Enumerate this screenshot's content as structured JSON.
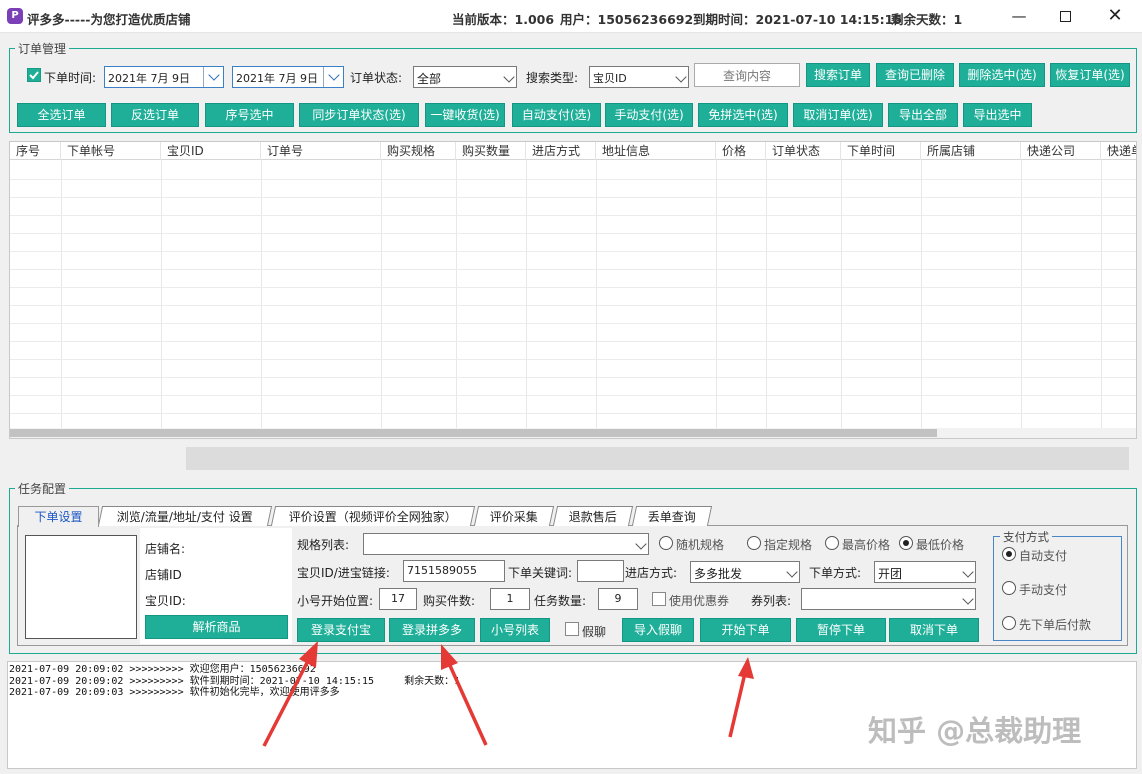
{
  "window": {
    "title": "评多多-----为您打造优质店铺",
    "version_label": "当前版本：1.006",
    "user_label": "用户：15056236692",
    "expiry_label": "到期时间：2021-07-10 14:15:15",
    "days_left_label": "剩余天数：1"
  },
  "order_panel": {
    "legend": "订单管理",
    "order_time_label": "下单时间:",
    "date_from": "2021年  7月  9日",
    "date_to": "2021年  7月  9日",
    "order_status_label": "订单状态:",
    "order_status_value": "全部",
    "search_type_label": "搜索类型:",
    "search_type_value": "宝贝ID",
    "query_placeholder": "查询内容",
    "buttons_row1": [
      "搜索订单",
      "查询已删除",
      "删除选中(选)",
      "恢复订单(选)"
    ],
    "buttons_row2": [
      "全选订单",
      "反选订单",
      "序号选中",
      "同步订单状态(选)",
      "一键收货(选)",
      "自动支付(选)",
      "手动支付(选)",
      "免拼选中(选)",
      "取消订单(选)",
      "导出全部",
      "导出选中"
    ]
  },
  "table": {
    "columns": [
      "序号",
      "下单帐号",
      "宝贝ID",
      "订单号",
      "购买规格",
      "购买数量",
      "进店方式",
      "地址信息",
      "价格",
      "订单状态",
      "下单时间",
      "所属店铺",
      "快递公司",
      "快递单"
    ],
    "rows": []
  },
  "task_panel": {
    "legend": "任务配置",
    "tabs": [
      "下单设置",
      "浏览/流量/地址/支付 设置",
      "评价设置（视频评价全网独家）",
      "评价采集",
      "退款售后",
      "丢单查询"
    ],
    "active_tab": "下单设置",
    "shop_name_label": "店铺名:",
    "shop_id_label": "店铺ID",
    "item_id_label": "宝贝ID:",
    "parse_button": "解析商品",
    "spec_list_label": "规格列表:",
    "spec_list_value": "",
    "spec_options": [
      "随机规格",
      "指定规格",
      "最高价格",
      "最低价格"
    ],
    "spec_selected": "最低价格",
    "item_link_label": "宝贝ID/进宝链接:",
    "item_link_value": "7151589055",
    "keyword_label": "下单关键词:",
    "keyword_value": "",
    "entry_method_label": "进店方式:",
    "entry_method_value": "多多批发",
    "order_method_label": "下单方式:",
    "order_method_value": "开团",
    "start_pos_label": "小号开始位置:",
    "start_pos_value": "17",
    "purchase_count_label": "购买件数:",
    "purchase_count_value": "1",
    "task_count_label": "任务数量:",
    "task_count_value": "9",
    "use_coupon_label": "使用优惠券",
    "coupon_list_label": "券列表:",
    "coupon_list_value": "",
    "fake_chat_label": "假聊",
    "buttons": [
      "登录支付宝",
      "登录拼多多",
      "小号列表",
      "导入假聊",
      "开始下单",
      "暂停下单",
      "取消下单"
    ],
    "payment": {
      "legend": "支付方式",
      "options": [
        "自动支付",
        "手动支付",
        "先下单后付款"
      ],
      "selected": "自动支付"
    }
  },
  "log": [
    "2021-07-09 20:09:02 >>>>>>>>> 欢迎您用户：15056236692",
    "2021-07-09 20:09:02 >>>>>>>>> 软件到期时间：2021-07-10 14:15:15     剩余天数：1",
    "2021-07-09 20:09:03 >>>>>>>>> 软件初始化完毕，欢迎使用评多多"
  ],
  "watermark": "知乎 @总裁助理",
  "colors": {
    "accent": "#1faf98",
    "arrow": "#e53935"
  }
}
